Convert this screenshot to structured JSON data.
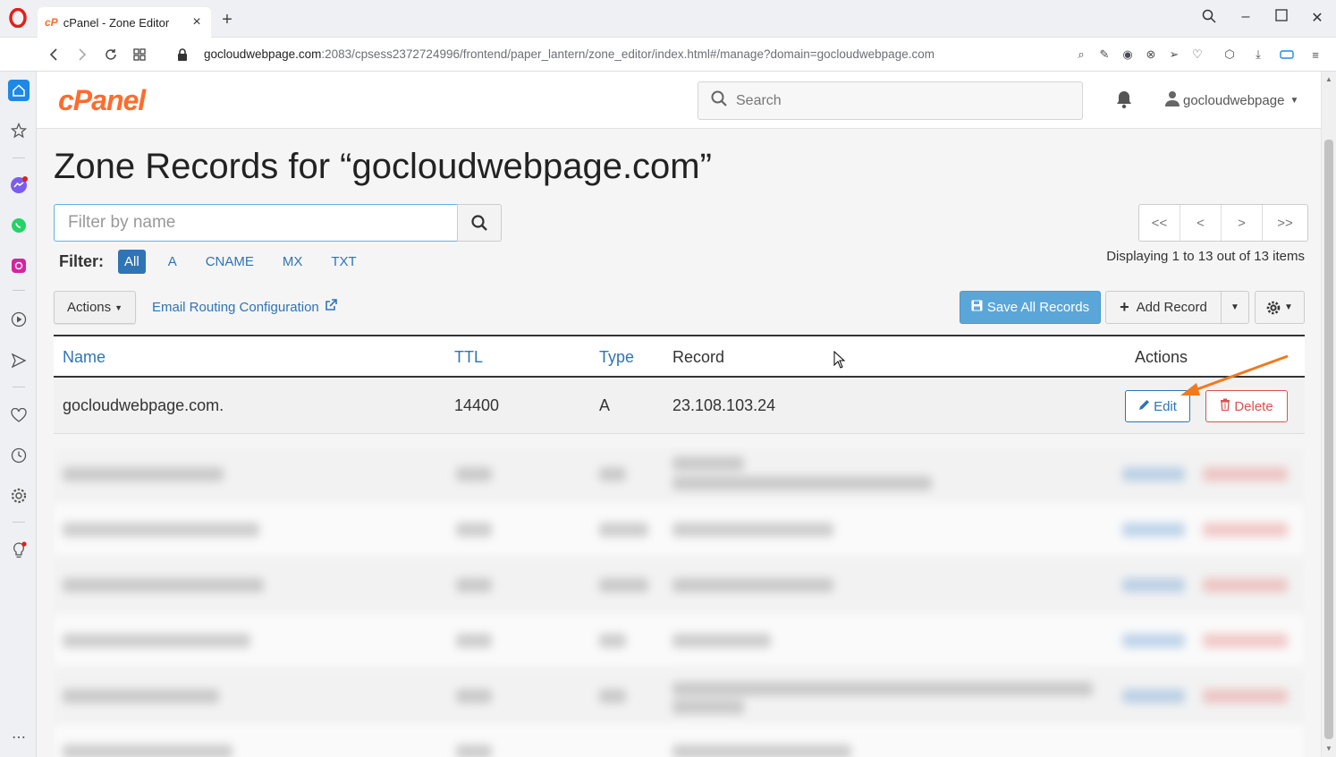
{
  "browser": {
    "tab_title": "cPanel - Zone Editor",
    "tab_favicon": "cP",
    "url_host": "gocloudwebpage.com",
    "url_path": ":2083/cpsess2372724996/frontend/paper_lantern/zone_editor/index.html#/manage?domain=gocloudwebpage.com"
  },
  "header": {
    "logo": "cPanel",
    "search_placeholder": "Search",
    "username": "gocloudwebpage"
  },
  "page": {
    "title": "Zone Records for “gocloudwebpage.com”",
    "filter_placeholder": "Filter by name",
    "filter_label": "Filter:",
    "filter_chips": [
      "All",
      "A",
      "CNAME",
      "MX",
      "TXT"
    ],
    "active_filter": "All",
    "pager": [
      "<<",
      "<",
      ">",
      ">>"
    ],
    "display_count": "Displaying 1 to 13 out of 13 items",
    "actions_label": "Actions",
    "email_routing_label": "Email Routing Configuration",
    "save_all_label": "Save All Records",
    "add_record_label": "Add Record"
  },
  "table": {
    "headers": {
      "name": "Name",
      "ttl": "TTL",
      "type": "Type",
      "record": "Record",
      "actions": "Actions"
    },
    "rows": [
      {
        "name": "gocloudwebpage.com.",
        "ttl": "14400",
        "type": "A",
        "record": "23.108.103.24",
        "edit": "Edit",
        "delete": "Delete"
      }
    ]
  },
  "colors": {
    "accent": "#2f74b5",
    "brand": "#ff6c2c",
    "danger": "#d9534f",
    "annotation_arrow": "#f07a1e"
  }
}
